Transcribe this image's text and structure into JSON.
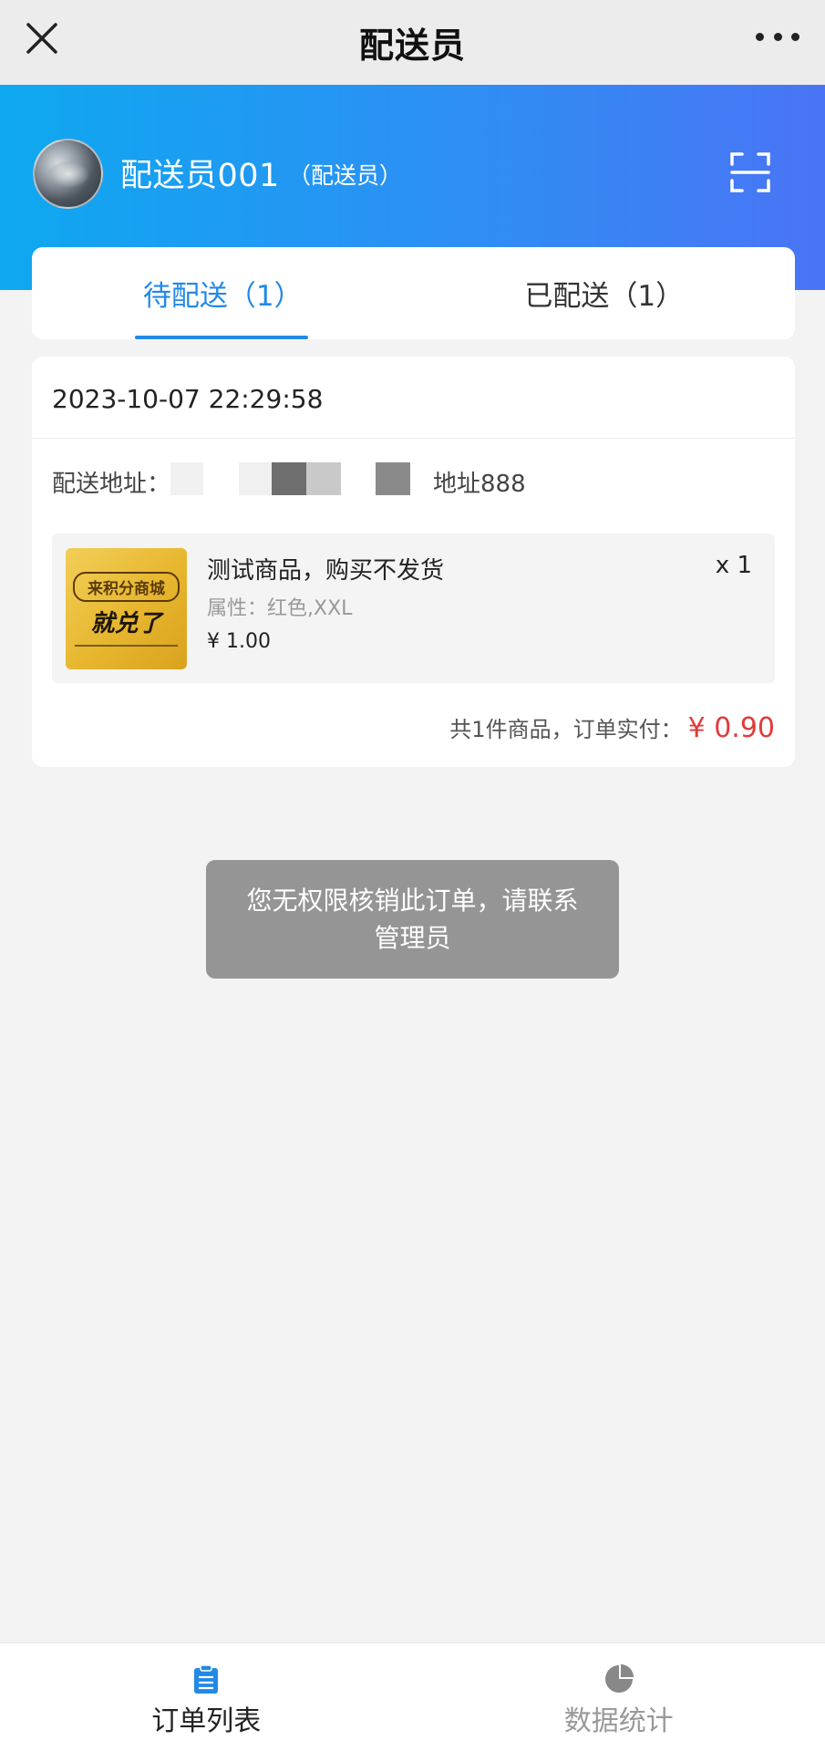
{
  "navbar": {
    "title": "配送员",
    "close_icon": "close-icon",
    "more_icon": "more-icon"
  },
  "header": {
    "user_name": "配送员001",
    "user_role": "（配送员）",
    "scan_icon": "scan-icon"
  },
  "tabs": [
    {
      "label": "待配送（1）",
      "active": true
    },
    {
      "label": "已配送（1）",
      "active": false
    }
  ],
  "order": {
    "time": "2023-10-07 22:29:58",
    "address_label": "配送地址：",
    "address_value": "地址888",
    "goods": {
      "name": "测试商品，购买不发货",
      "quantity": "x 1",
      "attributes": "属性：红色,XXL",
      "price": "¥ 1.00",
      "thumb_line1": "来积分商城",
      "thumb_line2": "就兑了"
    },
    "summary_text": "共1件商品，订单实付：",
    "summary_amount": "¥ 0.90"
  },
  "toast": {
    "message": "您无权限核销此订单，请联系管理员"
  },
  "bottom_tabs": [
    {
      "label": "订单列表",
      "icon": "clipboard-icon",
      "active": true
    },
    {
      "label": "数据统计",
      "icon": "pie-chart-icon",
      "active": false
    }
  ],
  "colors": {
    "accent": "#2389e6",
    "price_red": "#e23a3a",
    "header_gradient_start": "#0ea8f0",
    "header_gradient_end": "#4a74f5",
    "toast_bg": "#959595",
    "page_bg": "#f3f3f3"
  }
}
